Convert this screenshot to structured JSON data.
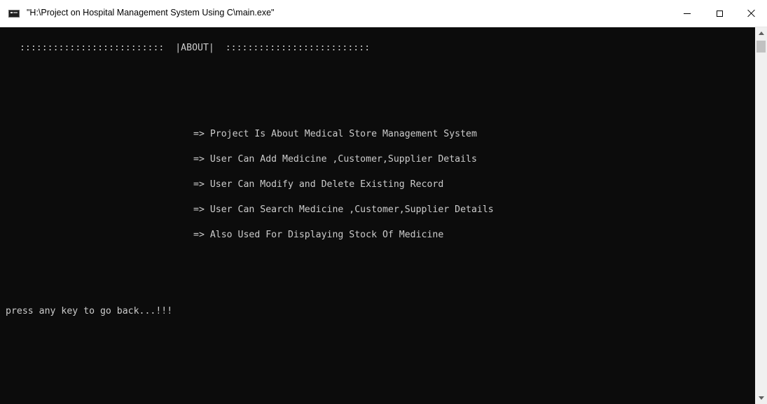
{
  "window": {
    "title": "\"H:\\Project on Hospital Management System Using C\\main.exe\"",
    "icon": "console-app-icon"
  },
  "titlebar_buttons": {
    "minimize_icon": "minimize-icon",
    "maximize_icon": "maximize-icon",
    "close_icon": "close-icon"
  },
  "console": {
    "header": " ::::::::::::::::::::::::::  |ABOUT|  ::::::::::::::::::::::::::",
    "lines": [
      "=> Project Is About Medical Store Management System",
      "=> User Can Add Medicine ,Customer,Supplier Details",
      "=> User Can Modify and Delete Existing Record",
      "=> User Can Search Medicine ,Customer,Supplier Details",
      "=> Also Used For Displaying Stock Of Medicine"
    ],
    "prompt": "press any key to go back...!!!"
  },
  "colors": {
    "console_background": "#0c0c0c",
    "console_text": "#cccccc",
    "titlebar_background": "#ffffff"
  }
}
